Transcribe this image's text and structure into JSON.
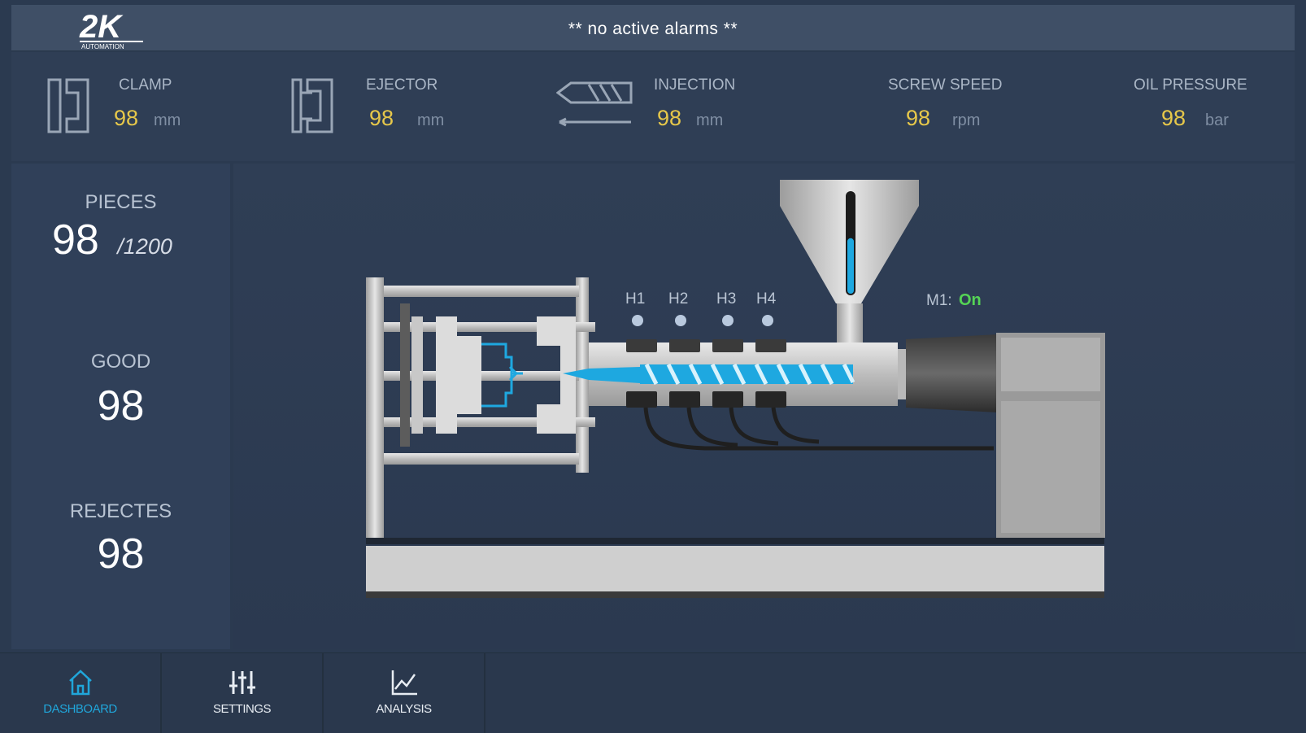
{
  "header": {
    "logo_text": "2K",
    "logo_subtext": "AUTOMATION",
    "alarm_message": "** no active alarms **"
  },
  "metrics": [
    {
      "label": "CLAMP",
      "value": "98",
      "unit": "mm",
      "icon": "clamp-icon"
    },
    {
      "label": "EJECTOR",
      "value": "98",
      "unit": "mm",
      "icon": "ejector-icon"
    },
    {
      "label": "INJECTION",
      "value": "98",
      "unit": "mm",
      "icon": "injection-icon"
    },
    {
      "label": "SCREW SPEED",
      "value": "98",
      "unit": "rpm"
    },
    {
      "label": "OIL PRESSURE",
      "value": "98",
      "unit": "bar"
    }
  ],
  "counters": {
    "pieces_label": "PIECES",
    "pieces_value": "98",
    "pieces_total": "/1200",
    "good_label": "GOOD",
    "good_value": "98",
    "rejects_label": "REJECTES",
    "rejects_value": "98"
  },
  "machine": {
    "heaters": [
      "H1",
      "H2",
      "H3",
      "H4"
    ],
    "motor_label": "M1:",
    "motor_status": "On",
    "hopper_level": 0.55,
    "colors": {
      "material": "#1ea8e0",
      "status_on": "#55d455",
      "metal": "#c4c4c4"
    }
  },
  "nav": {
    "items": [
      {
        "label": "DASHBOARD",
        "icon": "home-icon",
        "active": true
      },
      {
        "label": "SETTINGS",
        "icon": "sliders-icon",
        "active": false
      },
      {
        "label": "ANALYSIS",
        "icon": "chart-icon",
        "active": false
      }
    ]
  }
}
